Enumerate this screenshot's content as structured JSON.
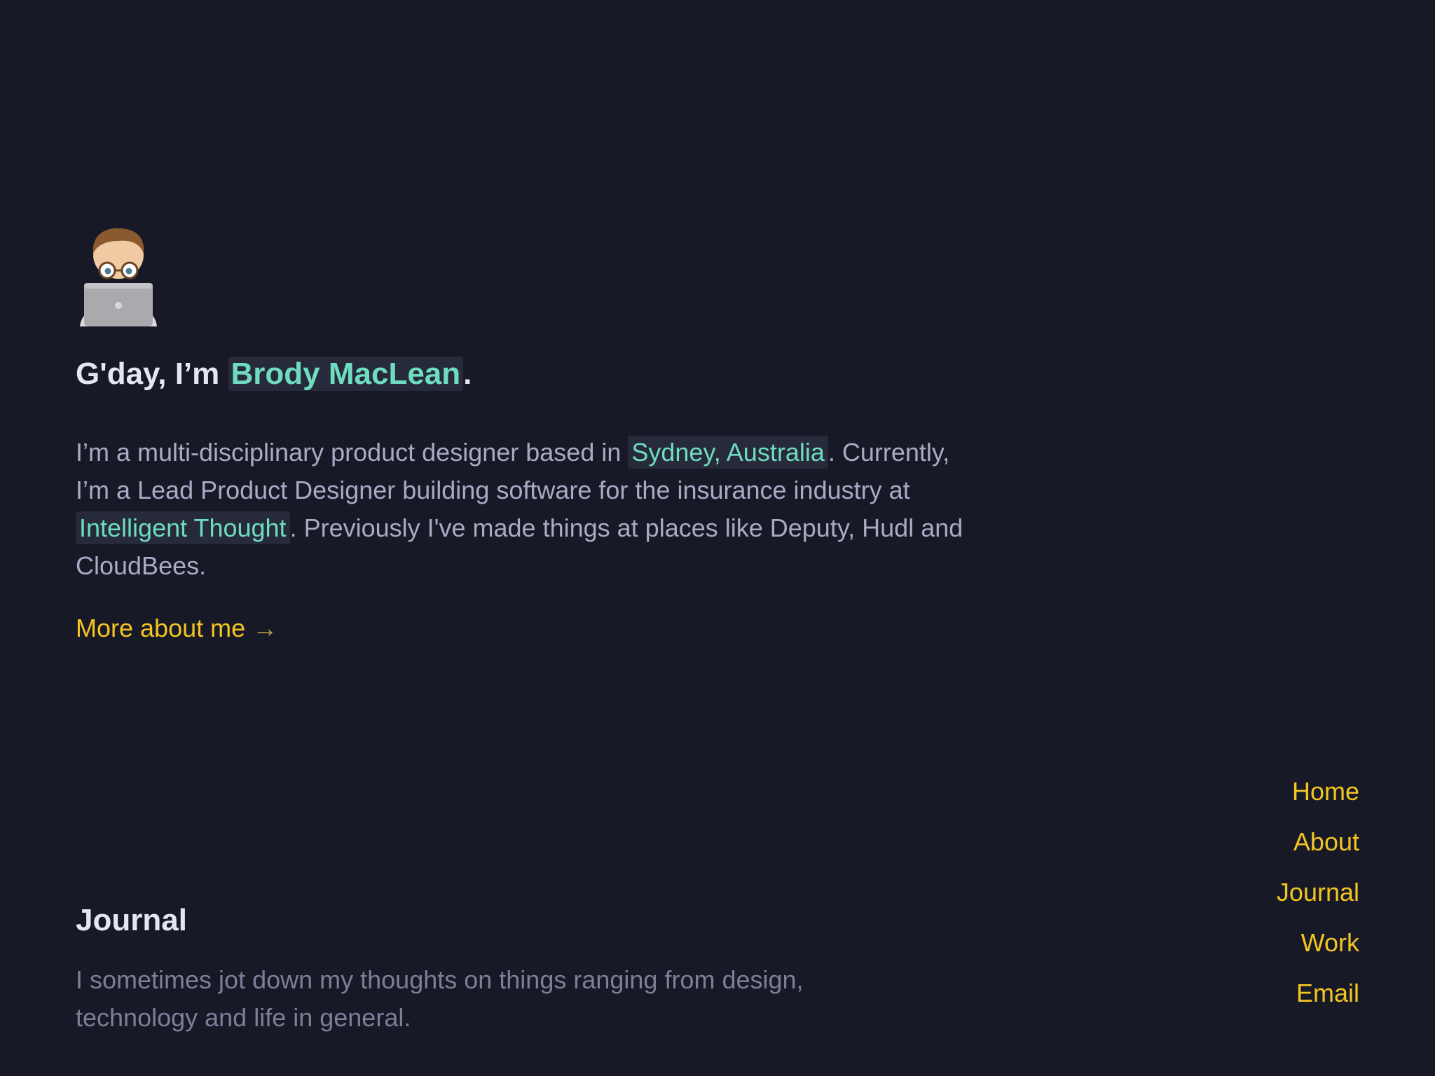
{
  "hero": {
    "avatar_icon": "memoji-laptop-icon",
    "greeting_prefix": "G'day, I’m ",
    "name": "Brody MacLean",
    "greeting_suffix": "."
  },
  "intro": {
    "part1": "I’m a multi-disciplinary product designer based in ",
    "location": "Sydney, Australia",
    "part2": ". Currently, I’m a Lead Product Designer building software for the insurance industry at ",
    "company": "Intelligent Thought",
    "part3": ". Previously I've made things at places like Deputy, Hudl and CloudBees."
  },
  "more_link": {
    "label": "More about me",
    "arrow": "→"
  },
  "journal": {
    "title": "Journal",
    "description": "I sometimes jot down my thoughts on things ranging from design, technology and life in general."
  },
  "nav": {
    "items": [
      "Home",
      "About",
      "Journal",
      "Work",
      "Email"
    ]
  },
  "colors": {
    "background": "#181926",
    "accent_yellow": "#f2c522",
    "accent_teal": "#6fdcc0",
    "highlight_bg": "#262a3a"
  }
}
